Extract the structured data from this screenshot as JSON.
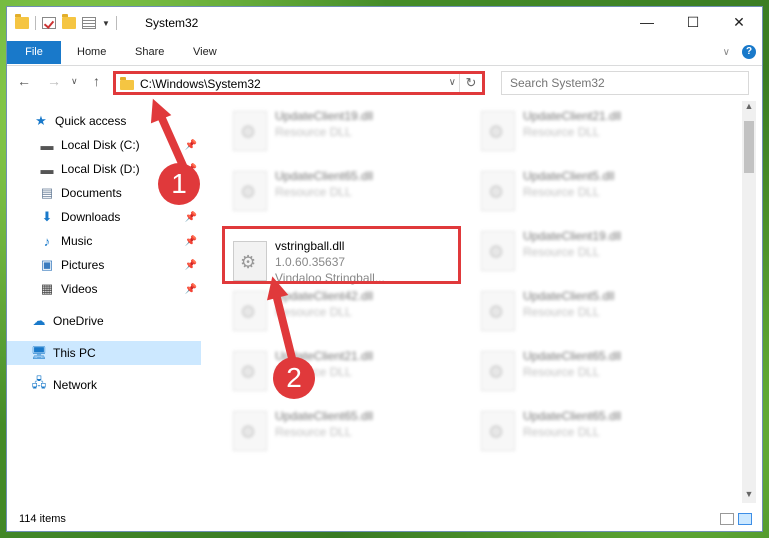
{
  "window": {
    "title": "System32"
  },
  "ribbon": {
    "tabs": [
      "File",
      "Home",
      "Share",
      "View"
    ],
    "help": "?"
  },
  "nav": {
    "address": "C:\\Windows\\System32",
    "search_placeholder": "Search System32"
  },
  "sidebar": {
    "items": [
      {
        "label": "Quick access",
        "icon": "star-icon"
      },
      {
        "label": "Local Disk (C:)",
        "icon": "drive-icon"
      },
      {
        "label": "Local Disk (D:)",
        "icon": "drive-icon"
      },
      {
        "label": "Documents",
        "icon": "documents-icon"
      },
      {
        "label": "Downloads",
        "icon": "download-icon"
      },
      {
        "label": "Music",
        "icon": "music-icon"
      },
      {
        "label": "Pictures",
        "icon": "pictures-icon"
      },
      {
        "label": "Videos",
        "icon": "videos-icon"
      },
      {
        "label": "OneDrive",
        "icon": "cloud-icon"
      },
      {
        "label": "This PC",
        "icon": "computer-icon"
      },
      {
        "label": "Network",
        "icon": "network-icon"
      }
    ]
  },
  "files": [
    {
      "name": "UpdateClient19.dll",
      "line2": "Resource DLL",
      "line3": ""
    },
    {
      "name": "UpdateClient21.dll",
      "line2": "Resource DLL",
      "line3": ""
    },
    {
      "name": "UpdateClient65.dll",
      "line2": "Resource DLL",
      "line3": ""
    },
    {
      "name": "UpdateClient5.dll",
      "line2": "Resource DLL",
      "line3": ""
    },
    {
      "name": "vstringball.dll",
      "line2": "1.0.60.35637",
      "line3": "Vindaloo Stringball..."
    },
    {
      "name": "UpdateClient19.dll",
      "line2": "Resource DLL",
      "line3": ""
    },
    {
      "name": "UpdateClient42.dll",
      "line2": "Resource DLL",
      "line3": ""
    },
    {
      "name": "UpdateClient5.dll",
      "line2": "Resource DLL",
      "line3": ""
    },
    {
      "name": "UpdateClient21.dll",
      "line2": "Resource DLL",
      "line3": ""
    },
    {
      "name": "UpdateClient65.dll",
      "line2": "Resource DLL",
      "line3": ""
    },
    {
      "name": "UpdateClient65.dll",
      "line2": "Resource DLL",
      "line3": ""
    },
    {
      "name": "UpdateClient65.dll",
      "line2": "Resource DLL",
      "line3": ""
    }
  ],
  "status": {
    "count": "114 items"
  },
  "annotations": {
    "step1": "1",
    "step2": "2"
  },
  "colors": {
    "accent": "#1979ca",
    "highlight": "#e0393b",
    "selection": "#cce8ff"
  }
}
